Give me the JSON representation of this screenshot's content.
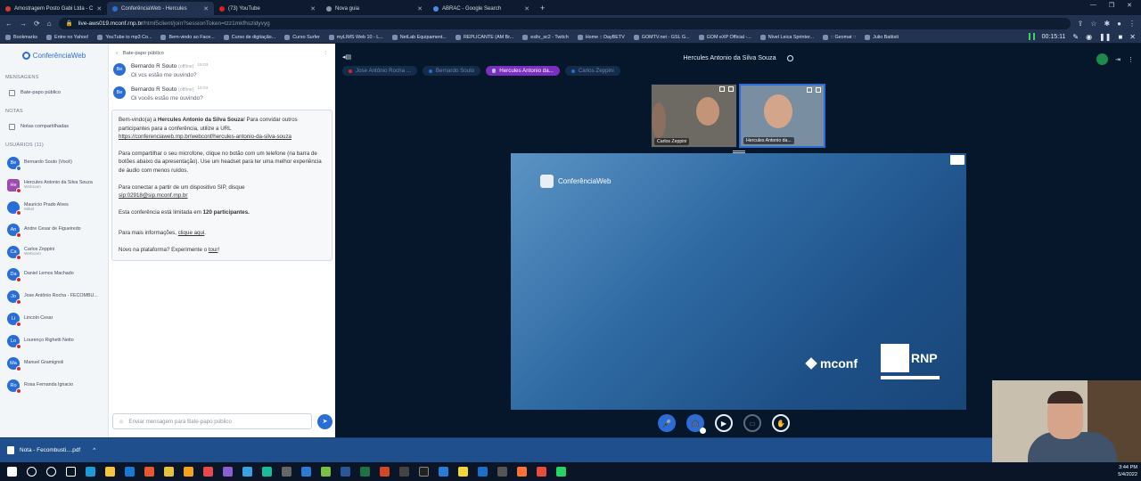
{
  "browser": {
    "tabs": [
      {
        "title": "Amostragem Posto Gabi Ltda - C",
        "color": "#d93c2e"
      },
      {
        "title": "ConferênciaWeb - Hercules",
        "color": "#2b6dd7",
        "active": true
      },
      {
        "title": "(73) YouTube",
        "color": "#e02020"
      },
      {
        "title": "Nova guia",
        "color": "#8a96a8"
      },
      {
        "title": "ABRAC - Google Search",
        "color": "#4a8bea"
      }
    ],
    "new_tab": "+",
    "url_host": "live-aws019.mconf.rnp.br",
    "url_path": "/html5client/join?sessionToken=tzz1mkfhszidyvyg",
    "bookmarks": [
      "Bookmarks",
      "Entre no Yahoo!",
      "YouTube to mp3 Co...",
      "Bem-vindo ao Face...",
      "Curso de digitação...",
      "Curso Surfer",
      "myLIMS Web 10 - L...",
      "NetLab Equipament...",
      "REPLICANTE (AM Br...",
      "esltv_sc2 - Twitch",
      "Home :: DayBETV",
      "GOMTV.net - GSL G...",
      "GOM eXP Official -...",
      "Nível Leica Sprinter...",
      ":: Geomat ::",
      "Julio Battisti"
    ],
    "timer": "00:15:11"
  },
  "sidebar": {
    "logo": "ConferênciaWeb",
    "messages_head": "MENSAGENS",
    "public_chat": "Bate-papo público",
    "notes_head": "NOTAS",
    "shared_notes": "Notas compartilhadas",
    "users_head": "USUÁRIOS (11)",
    "users": [
      {
        "initials": "Be",
        "name": "Bernardo Souto (Você)",
        "sub": "",
        "presenter": false,
        "status": "ok"
      },
      {
        "initials": "He",
        "name": "Hercules Antonio da Silva Souza",
        "sub": "Webcam",
        "presenter": true,
        "status": "off"
      },
      {
        "initials": "",
        "name": "Mauricio Prado Alves",
        "sub": "Mikel",
        "presenter": false,
        "status": "off"
      },
      {
        "initials": "An",
        "name": "Andre Cesar de Figueiredo",
        "sub": "",
        "presenter": false,
        "status": "off"
      },
      {
        "initials": "Ca",
        "name": "Carlos Zeppini",
        "sub": "Webcam",
        "presenter": false,
        "status": "off"
      },
      {
        "initials": "Da",
        "name": "Daniel Lemos Machado",
        "sub": "",
        "presenter": false,
        "status": "off"
      },
      {
        "initials": "Jo",
        "name": "Jose Antônio Rocha - FECOMBU...",
        "sub": "",
        "presenter": false,
        "status": "off"
      },
      {
        "initials": "Li",
        "name": "Lincoln Cesar",
        "sub": "",
        "presenter": false,
        "status": "off"
      },
      {
        "initials": "Lo",
        "name": "Lourenço Righetti Netto",
        "sub": "",
        "presenter": false,
        "status": "off"
      },
      {
        "initials": "Ma",
        "name": "Manuel Gramignoli",
        "sub": "",
        "presenter": false,
        "status": "off"
      },
      {
        "initials": "Ro",
        "name": "Rosa Fernanda Ignacio",
        "sub": "",
        "presenter": false,
        "status": "off"
      }
    ]
  },
  "chat": {
    "header": "Bate-papo público",
    "messages": [
      {
        "initials": "Be",
        "name": "Bernardo R Souto",
        "status": "(offline)",
        "time": "15:03",
        "text": "Oi vcs estão me ouvindo?"
      },
      {
        "initials": "Be",
        "name": "Bernardo R Souto",
        "status": "(offline)",
        "time": "15:04",
        "text": "Oi vocês estão me ouvindo?"
      }
    ],
    "welcome": {
      "p1_a": "Bem-vindo(a) a ",
      "p1_b": "Hercules Antonio da Silva Souza",
      "p1_c": "! Para convidar outros participantes para a conferência, utilize a URL",
      "p1_link": "https://conferenciaweb.rnp.br/webconf/hercules-antonio-da-silva-souza",
      "p2": "Para compartilhar o seu microfone, clique no botão com um telefone (na barra de botões abaixo da apresentação). Use um headset para ter uma melhor experiência de áudio com menos ruídos.",
      "p3": "Para conectar a partir de um dispositivo SIP, disque",
      "p3_link": "sip:02918@sip.mconf.rnp.br",
      "p4_a": "Esta conferência está limitada em ",
      "p4_b": "120 participantes.",
      "p5_a": "Para mais informações, ",
      "p5_link": "clique aqui",
      "p6_a": "Novo na plataforma? Experimente o ",
      "p6_link": "tour",
      "p6_c": "!"
    },
    "input_placeholder": "Enviar mensagem para Bate-papo público"
  },
  "meeting": {
    "title": "Hercules Antonio da Silva Souza",
    "talkers": [
      {
        "name": "Jose Antônio Rocha ...",
        "active": false
      },
      {
        "name": "Bernardo Souto",
        "active": false
      },
      {
        "name": "Hercules Antonio da...",
        "active": true
      },
      {
        "name": "Carlos Zeppini",
        "active": false
      }
    ],
    "cams": [
      {
        "label": "Carlos Zeppini"
      },
      {
        "label": "Hercules Antonio da..."
      }
    ],
    "slide_logo": "ConferênciaWeb",
    "mconf": "mconf",
    "rnp": "RNP"
  },
  "download": {
    "file": "Nota - Fecombusti....pdf",
    "chevron": "^"
  },
  "clock": {
    "time": "3:44 PM",
    "date": "5/4/2022"
  }
}
